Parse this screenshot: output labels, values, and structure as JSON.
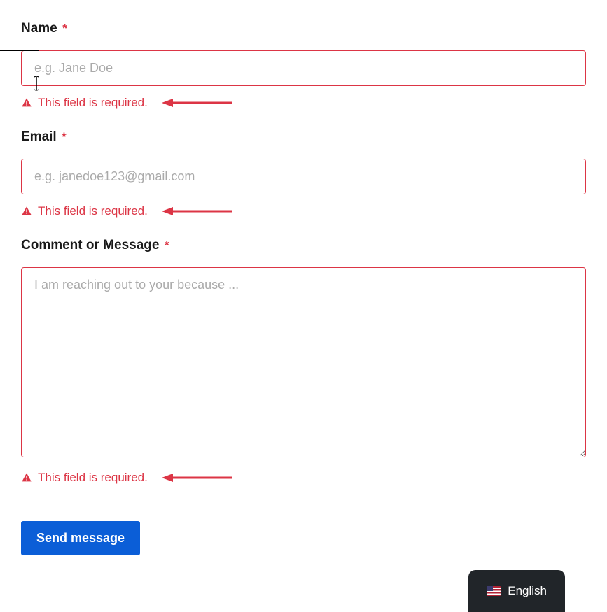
{
  "form": {
    "fields": {
      "name": {
        "label": "Name",
        "required_mark": "*",
        "placeholder": "e.g. Jane Doe",
        "value": "",
        "error": "This field is required."
      },
      "email": {
        "label": "Email",
        "required_mark": "*",
        "placeholder": "e.g. janedoe123@gmail.com",
        "value": "",
        "error": "This field is required."
      },
      "message": {
        "label": "Comment or Message",
        "required_mark": "*",
        "placeholder": "I am reaching out to your because ...",
        "value": "",
        "error": "This field is required."
      }
    },
    "submit_label": "Send message"
  },
  "language_selector": {
    "label": "English"
  },
  "colors": {
    "error": "#dc3545",
    "primary": "#0b5ed7",
    "dark": "#212529"
  }
}
